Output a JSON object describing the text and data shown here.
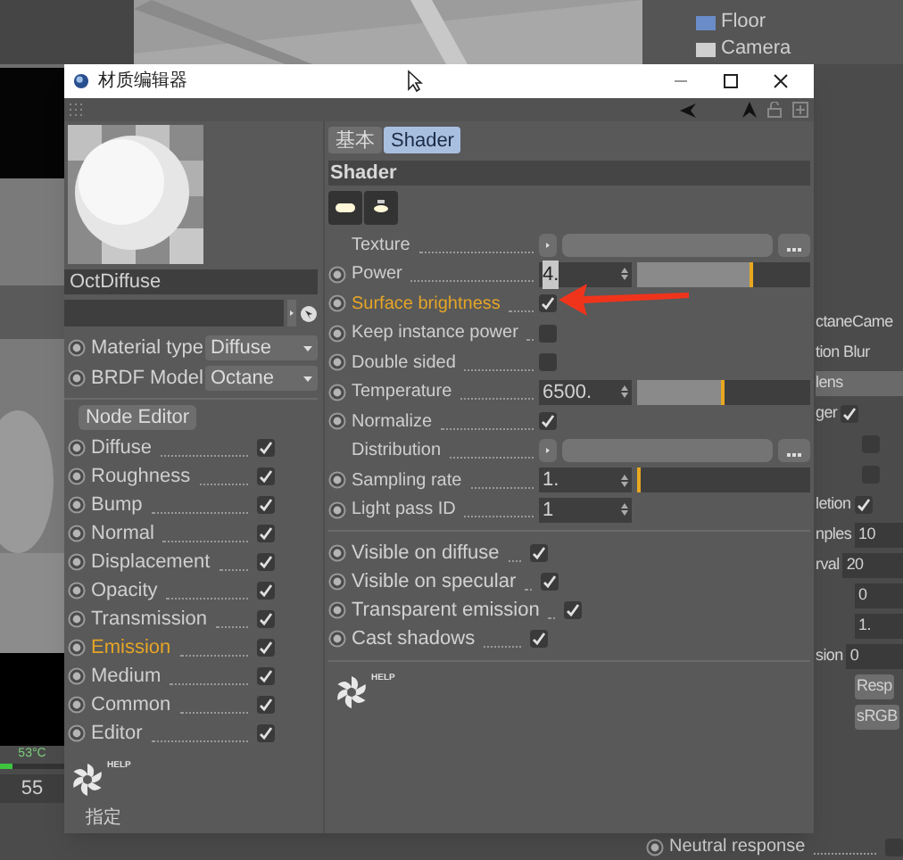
{
  "window": {
    "title": "材质编辑器"
  },
  "preview": {
    "name": "OctDiffuse"
  },
  "material_props": [
    {
      "label": "Material type",
      "value": "Diffuse"
    },
    {
      "label": "BRDF Model",
      "value": "Octane"
    }
  ],
  "node_editor_button": "Node Editor",
  "channels": [
    {
      "label": "Diffuse",
      "checked": true,
      "highlighted": false
    },
    {
      "label": "Roughness",
      "checked": true,
      "highlighted": false
    },
    {
      "label": "Bump",
      "checked": true,
      "highlighted": false
    },
    {
      "label": "Normal",
      "checked": true,
      "highlighted": false
    },
    {
      "label": "Displacement",
      "checked": true,
      "highlighted": false
    },
    {
      "label": "Opacity",
      "checked": true,
      "highlighted": false
    },
    {
      "label": "Transmission",
      "checked": true,
      "highlighted": false
    },
    {
      "label": "Emission",
      "checked": true,
      "highlighted": true
    },
    {
      "label": "Medium",
      "checked": true,
      "highlighted": false
    },
    {
      "label": "Common",
      "checked": true,
      "highlighted": false
    },
    {
      "label": "Editor",
      "checked": true,
      "highlighted": false
    }
  ],
  "help_labels": [
    "HELP",
    "HELP"
  ],
  "assign_label": "指定",
  "tabs": [
    {
      "label": "基本",
      "selected": false
    },
    {
      "label": "Shader",
      "selected": true
    }
  ],
  "section_title": "Shader",
  "shader_params": [
    {
      "kind": "link",
      "label": "Texture",
      "highlighted": false
    },
    {
      "kind": "slider",
      "label": "Power",
      "value": "4.",
      "level": 0.67,
      "highlighted": false
    },
    {
      "kind": "check",
      "label": "Surface brightness",
      "checked": true,
      "highlighted": true
    },
    {
      "kind": "check",
      "label": "Keep instance power",
      "checked": false,
      "highlighted": false
    },
    {
      "kind": "check",
      "label": "Double sided",
      "checked": false,
      "highlighted": false
    },
    {
      "kind": "slider",
      "label": "Temperature",
      "value": "6500.",
      "level": 0.51,
      "highlighted": false
    },
    {
      "kind": "check",
      "label": "Normalize",
      "checked": true,
      "highlighted": false
    },
    {
      "kind": "link",
      "label": "Distribution",
      "highlighted": false
    },
    {
      "kind": "slider",
      "label": "Sampling rate",
      "value": "1.",
      "level": 0.01,
      "highlighted": false
    },
    {
      "kind": "number",
      "label": "Light pass ID",
      "value": "1",
      "highlighted": false
    }
  ],
  "visibility": [
    {
      "label": "Visible on diffuse",
      "checked": true
    },
    {
      "label": "Visible on specular",
      "checked": true
    },
    {
      "label": "Transparent emission",
      "checked": true
    },
    {
      "label": "Cast shadows",
      "checked": true
    }
  ],
  "scene": [
    {
      "label": "Floor"
    },
    {
      "label": "Camera"
    }
  ],
  "right_panel": [
    {
      "kind": "text",
      "label": "ctaneCame"
    },
    {
      "kind": "text",
      "label": "tion Blur"
    },
    {
      "kind": "bar",
      "label": "lens"
    },
    {
      "kind": "check",
      "label": "ger",
      "checked": true
    },
    {
      "kind": "check",
      "checked": false
    },
    {
      "kind": "check",
      "checked": false
    },
    {
      "kind": "check",
      "label": "letion",
      "checked": true
    },
    {
      "kind": "field",
      "label": "nples",
      "value": "10"
    },
    {
      "kind": "field",
      "label": "rval",
      "value": "20"
    },
    {
      "kind": "field",
      "value": "0"
    },
    {
      "kind": "field",
      "value": "1."
    },
    {
      "kind": "field",
      "label": "sion",
      "value": "0"
    },
    {
      "kind": "button",
      "label": "Resp"
    },
    {
      "kind": "button",
      "label": "sRGB"
    }
  ],
  "status": {
    "temperature": "53°C",
    "value": "55"
  },
  "bottom_row": {
    "label": "Neutral response",
    "checked": false
  }
}
